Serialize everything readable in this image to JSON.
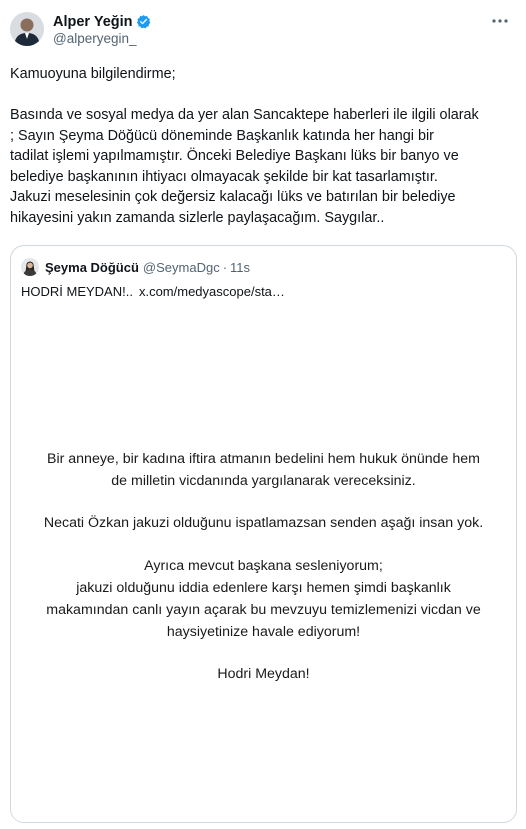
{
  "author": {
    "display_name": "Alper Yeğin",
    "handle": "@alperyegin_",
    "verified_color": "#1d9bf0"
  },
  "tweet": {
    "intro": "Kamuoyuna bilgilendirme;",
    "body_lines": [
      "Basında ve sosyal medya da yer alan Sancaktepe haberleri ile ilgili olarak",
      "; Sayın Şeyma Döğücü döneminde  Başkanlık katında her hangi bir",
      "tadilat işlemi yapılmamıştır. Önceki Belediye Başkanı lüks bir banyo ve",
      "belediye başkanının ihtiyacı olmayacak şekilde bir kat tasarlamıştır.",
      "Jakuzi meselesinin çok değersiz kalacağı  lüks ve batırılan bir belediye",
      "hikayesini yakın zamanda sizlerle paylaşacağım. Saygılar.."
    ]
  },
  "quote": {
    "display_name": "Şeyma Döğücü",
    "handle": "@SeymaDgc",
    "dot": "·",
    "time": "11s",
    "text": "HODRİ MEYDAN!..",
    "link": "x.com/medyascope/sta…",
    "statement": {
      "p1_line1": "Bir anneye, bir kadına iftira atmanın bedelini hem hukuk önünde hem",
      "p1_line2": "de milletin vicdanında yargılanarak vereceksiniz.",
      "p2": "Necati Özkan jakuzi olduğunu ispatlamazsan senden aşağı insan yok.",
      "p3_line1": "Ayrıca mevcut başkana sesleniyorum;",
      "p3_line2": "jakuzi olduğunu iddia edenlere karşı hemen şimdi başkanlık",
      "p3_line3": "makamından canlı yayın açarak bu mevzuyu temizlemenizi vicdan ve",
      "p3_line4": "haysiyetinize havale ediyorum!",
      "closing": "Hodri Meydan!"
    }
  }
}
